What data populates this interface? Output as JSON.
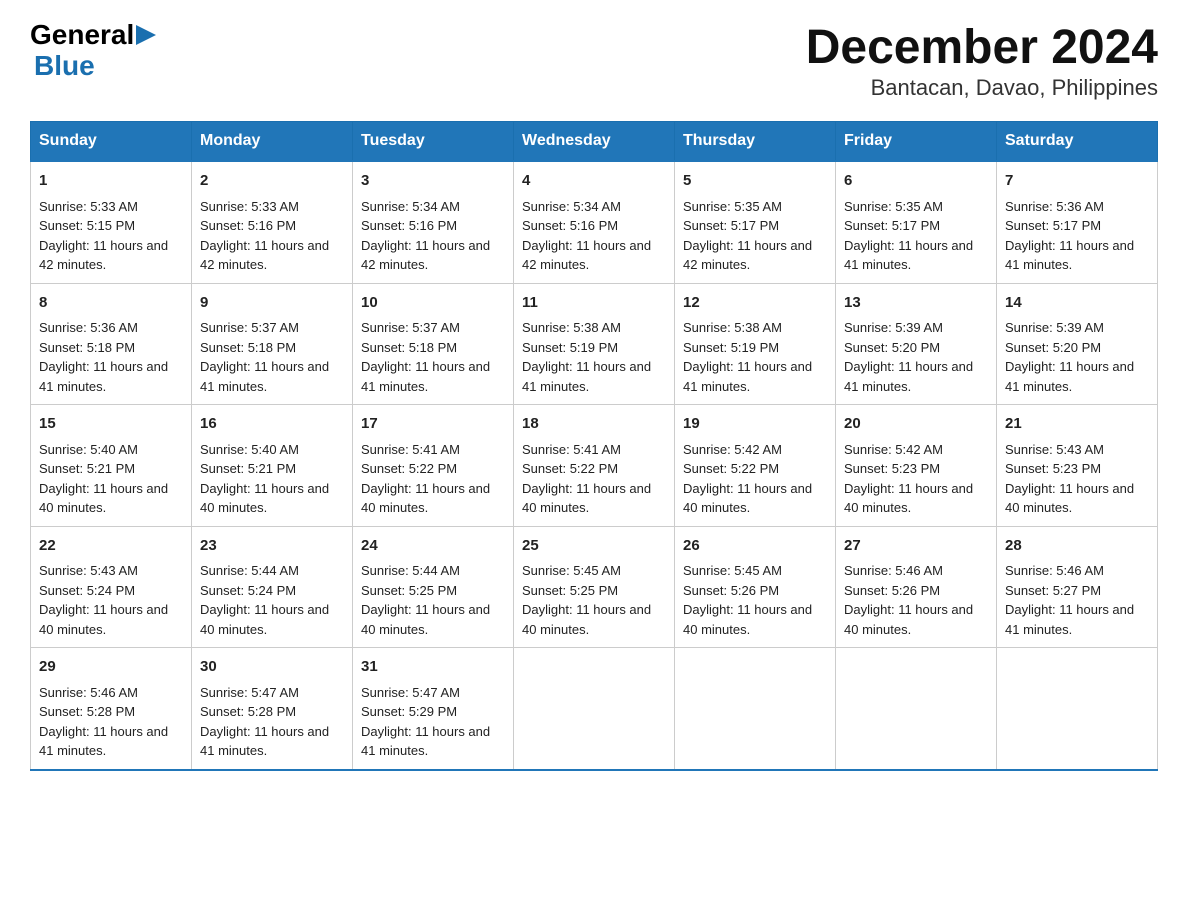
{
  "logo": {
    "text_general": "General",
    "text_blue": "Blue"
  },
  "title": "December 2024",
  "subtitle": "Bantacan, Davao, Philippines",
  "headers": [
    "Sunday",
    "Monday",
    "Tuesday",
    "Wednesday",
    "Thursday",
    "Friday",
    "Saturday"
  ],
  "weeks": [
    [
      {
        "day": "1",
        "sunrise": "5:33 AM",
        "sunset": "5:15 PM",
        "daylight": "11 hours and 42 minutes."
      },
      {
        "day": "2",
        "sunrise": "5:33 AM",
        "sunset": "5:16 PM",
        "daylight": "11 hours and 42 minutes."
      },
      {
        "day": "3",
        "sunrise": "5:34 AM",
        "sunset": "5:16 PM",
        "daylight": "11 hours and 42 minutes."
      },
      {
        "day": "4",
        "sunrise": "5:34 AM",
        "sunset": "5:16 PM",
        "daylight": "11 hours and 42 minutes."
      },
      {
        "day": "5",
        "sunrise": "5:35 AM",
        "sunset": "5:17 PM",
        "daylight": "11 hours and 42 minutes."
      },
      {
        "day": "6",
        "sunrise": "5:35 AM",
        "sunset": "5:17 PM",
        "daylight": "11 hours and 41 minutes."
      },
      {
        "day": "7",
        "sunrise": "5:36 AM",
        "sunset": "5:17 PM",
        "daylight": "11 hours and 41 minutes."
      }
    ],
    [
      {
        "day": "8",
        "sunrise": "5:36 AM",
        "sunset": "5:18 PM",
        "daylight": "11 hours and 41 minutes."
      },
      {
        "day": "9",
        "sunrise": "5:37 AM",
        "sunset": "5:18 PM",
        "daylight": "11 hours and 41 minutes."
      },
      {
        "day": "10",
        "sunrise": "5:37 AM",
        "sunset": "5:18 PM",
        "daylight": "11 hours and 41 minutes."
      },
      {
        "day": "11",
        "sunrise": "5:38 AM",
        "sunset": "5:19 PM",
        "daylight": "11 hours and 41 minutes."
      },
      {
        "day": "12",
        "sunrise": "5:38 AM",
        "sunset": "5:19 PM",
        "daylight": "11 hours and 41 minutes."
      },
      {
        "day": "13",
        "sunrise": "5:39 AM",
        "sunset": "5:20 PM",
        "daylight": "11 hours and 41 minutes."
      },
      {
        "day": "14",
        "sunrise": "5:39 AM",
        "sunset": "5:20 PM",
        "daylight": "11 hours and 41 minutes."
      }
    ],
    [
      {
        "day": "15",
        "sunrise": "5:40 AM",
        "sunset": "5:21 PM",
        "daylight": "11 hours and 40 minutes."
      },
      {
        "day": "16",
        "sunrise": "5:40 AM",
        "sunset": "5:21 PM",
        "daylight": "11 hours and 40 minutes."
      },
      {
        "day": "17",
        "sunrise": "5:41 AM",
        "sunset": "5:22 PM",
        "daylight": "11 hours and 40 minutes."
      },
      {
        "day": "18",
        "sunrise": "5:41 AM",
        "sunset": "5:22 PM",
        "daylight": "11 hours and 40 minutes."
      },
      {
        "day": "19",
        "sunrise": "5:42 AM",
        "sunset": "5:22 PM",
        "daylight": "11 hours and 40 minutes."
      },
      {
        "day": "20",
        "sunrise": "5:42 AM",
        "sunset": "5:23 PM",
        "daylight": "11 hours and 40 minutes."
      },
      {
        "day": "21",
        "sunrise": "5:43 AM",
        "sunset": "5:23 PM",
        "daylight": "11 hours and 40 minutes."
      }
    ],
    [
      {
        "day": "22",
        "sunrise": "5:43 AM",
        "sunset": "5:24 PM",
        "daylight": "11 hours and 40 minutes."
      },
      {
        "day": "23",
        "sunrise": "5:44 AM",
        "sunset": "5:24 PM",
        "daylight": "11 hours and 40 minutes."
      },
      {
        "day": "24",
        "sunrise": "5:44 AM",
        "sunset": "5:25 PM",
        "daylight": "11 hours and 40 minutes."
      },
      {
        "day": "25",
        "sunrise": "5:45 AM",
        "sunset": "5:25 PM",
        "daylight": "11 hours and 40 minutes."
      },
      {
        "day": "26",
        "sunrise": "5:45 AM",
        "sunset": "5:26 PM",
        "daylight": "11 hours and 40 minutes."
      },
      {
        "day": "27",
        "sunrise": "5:46 AM",
        "sunset": "5:26 PM",
        "daylight": "11 hours and 40 minutes."
      },
      {
        "day": "28",
        "sunrise": "5:46 AM",
        "sunset": "5:27 PM",
        "daylight": "11 hours and 41 minutes."
      }
    ],
    [
      {
        "day": "29",
        "sunrise": "5:46 AM",
        "sunset": "5:28 PM",
        "daylight": "11 hours and 41 minutes."
      },
      {
        "day": "30",
        "sunrise": "5:47 AM",
        "sunset": "5:28 PM",
        "daylight": "11 hours and 41 minutes."
      },
      {
        "day": "31",
        "sunrise": "5:47 AM",
        "sunset": "5:29 PM",
        "daylight": "11 hours and 41 minutes."
      },
      null,
      null,
      null,
      null
    ]
  ],
  "labels": {
    "sunrise": "Sunrise:",
    "sunset": "Sunset:",
    "daylight": "Daylight:"
  }
}
